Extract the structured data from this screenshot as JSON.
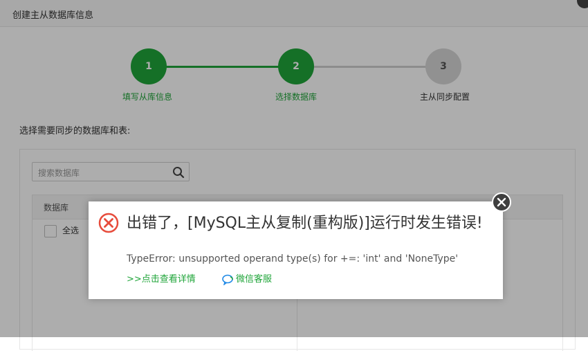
{
  "window": {
    "title": "创建主从数据库信息"
  },
  "steps": [
    {
      "number": "1",
      "label": "填写从库信息",
      "state": "active"
    },
    {
      "number": "2",
      "label": "选择数据库",
      "state": "active"
    },
    {
      "number": "3",
      "label": "主从同步配置",
      "state": "todo"
    }
  ],
  "main": {
    "prompt": "选择需要同步的数据库和表:",
    "search": {
      "placeholder": "搜索数据库"
    },
    "table": {
      "header": "数据库",
      "select_all": "全选"
    }
  },
  "error_dialog": {
    "title": "出错了，[MySQL主从复制(重构版)]运行时发生错误!",
    "message": "TypeError: unsupported operand type(s) for +=: 'int' and 'NoneType'",
    "detail_link": ">>点击查看详情",
    "wechat_link": "微信客服"
  },
  "colors": {
    "accent": "#20a53a",
    "error": "#e74c3c"
  }
}
